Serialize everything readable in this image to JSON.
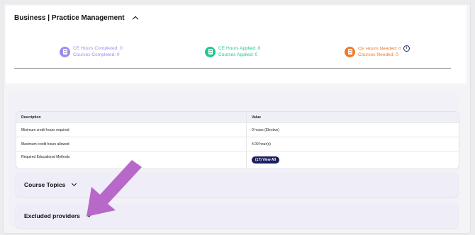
{
  "section": {
    "title": "Business | Practice Management"
  },
  "stats": [
    {
      "line1": "CE Hours Completed: 0",
      "line2": "Courses Completed: 0",
      "color": "#9b8cf2",
      "icon": "document-icon"
    },
    {
      "line1": "CE Hours Applied: 0",
      "line2": "Courses Applied: 0",
      "color": "#23c693",
      "icon": "document-icon"
    },
    {
      "line1": "CE Hours Needed: 0",
      "line2": "Courses Needed: 0",
      "color": "#f17a2a",
      "icon": "document-icon",
      "info": "i"
    }
  ],
  "table": {
    "headers": {
      "description": "Description",
      "value": "Value"
    },
    "rows": [
      {
        "description": "Minimum credit hours required",
        "value": "0 hours (Elective)"
      },
      {
        "description": "Maximum credit hours allowed",
        "value": "4.00 hour(s)"
      },
      {
        "description": "Required Educational Methods",
        "value": "(17) View All"
      }
    ]
  },
  "accordions": {
    "course_topics": "Course Topics",
    "excluded_providers": "Excluded providers"
  },
  "colors": {
    "arrow": "#b768c8",
    "pill": "#1b1f5e"
  }
}
